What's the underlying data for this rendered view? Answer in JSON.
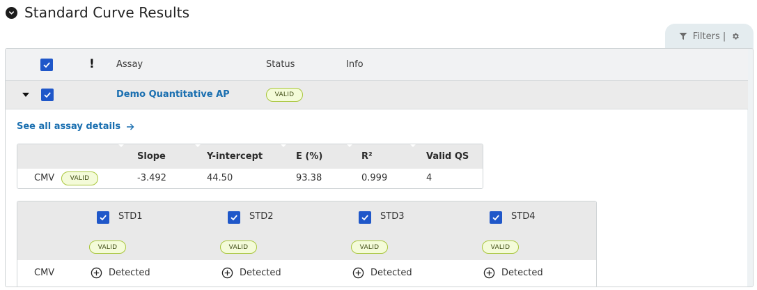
{
  "page": {
    "title": "Standard Curve Results",
    "collapse_icon": "chevron-down-icon"
  },
  "filters": {
    "label": "Filters |",
    "filter_icon": "funnel-icon",
    "settings_icon": "gear-icon"
  },
  "table": {
    "columns": [
      "!",
      "Assay",
      "Status",
      "Info"
    ],
    "rows": [
      {
        "assay": "Demo Quantitative AP",
        "status": "VALID",
        "expanded": true,
        "checked": true
      }
    ]
  },
  "details": {
    "link_label": "See all assay details",
    "metrics": {
      "headers": [
        "Slope",
        "Y-intercept",
        "E (%)",
        "R²",
        "Valid QS"
      ],
      "rows": [
        {
          "target": "CMV",
          "status": "VALID",
          "values": [
            "-3.492",
            "44.50",
            "93.38",
            "0.999",
            "4"
          ]
        }
      ]
    },
    "standards": {
      "items": [
        {
          "label": "STD1",
          "status": "VALID",
          "checked": true
        },
        {
          "label": "STD2",
          "status": "VALID",
          "checked": true
        },
        {
          "label": "STD3",
          "status": "VALID",
          "checked": true
        },
        {
          "label": "STD4",
          "status": "VALID",
          "checked": true
        }
      ],
      "rows": [
        {
          "target": "CMV",
          "results": [
            "Detected",
            "Detected",
            "Detected",
            "Detected"
          ],
          "result_icon": "plus-circle-icon"
        }
      ]
    }
  },
  "colors": {
    "accent": "#1f57c9",
    "link": "#1a6fb0",
    "valid_badge_bg": "#f4fbd9",
    "valid_badge_border": "#a8c63a"
  }
}
